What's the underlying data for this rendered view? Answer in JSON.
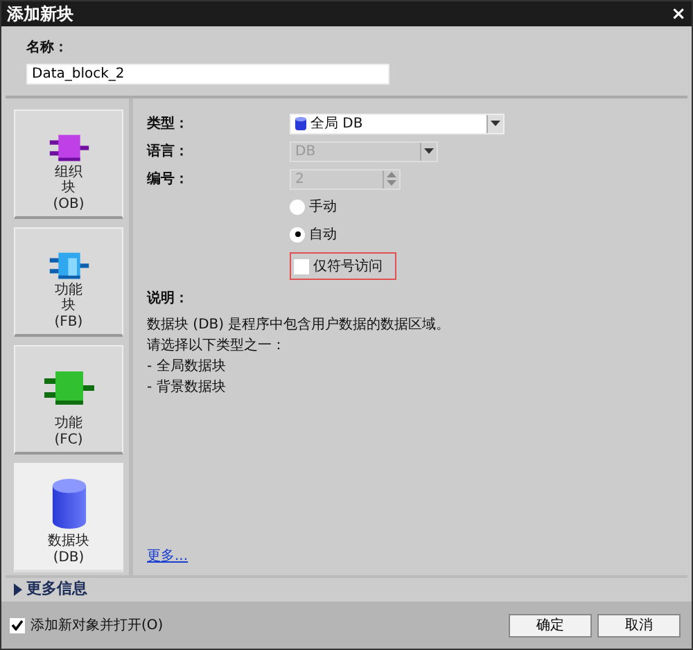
{
  "window": {
    "title": "添加新块",
    "close": "×"
  },
  "name_field": {
    "label": "名称：",
    "value": "Data_block_2"
  },
  "block_types": [
    {
      "kind": "ob",
      "label": "组织块",
      "code": "(OB)",
      "selected": false
    },
    {
      "kind": "fb",
      "label": "功能块",
      "code": "(FB)",
      "selected": false
    },
    {
      "kind": "fc",
      "label": "功能",
      "code": "(FC)",
      "selected": false
    },
    {
      "kind": "db",
      "label": "数据块",
      "code": "(DB)",
      "selected": true
    }
  ],
  "properties": {
    "type": {
      "label": "类型：",
      "value": "全局 DB"
    },
    "language": {
      "label": "语言：",
      "value": "DB",
      "disabled": true
    },
    "number": {
      "label": "编号：",
      "value": "2",
      "disabled": true
    },
    "numbering": [
      {
        "label": "手动",
        "selected": false
      },
      {
        "label": "自动",
        "selected": true
      }
    ],
    "symbolic_only": {
      "label": "仅符号访问",
      "checked": false
    }
  },
  "description": {
    "label": "说明：",
    "lines": [
      "数据块 (DB) 是程序中包含用户数据的数据区域。",
      "请选择以下类型之一：",
      "- 全局数据块",
      "- 背景数据块"
    ],
    "more_link": "更多..."
  },
  "more_info": {
    "label": "更多信息",
    "expanded": false
  },
  "footer": {
    "open_after_add": {
      "label": "添加新对象并打开(O)",
      "checked": true
    },
    "buttons": [
      "确定",
      "取消"
    ]
  }
}
